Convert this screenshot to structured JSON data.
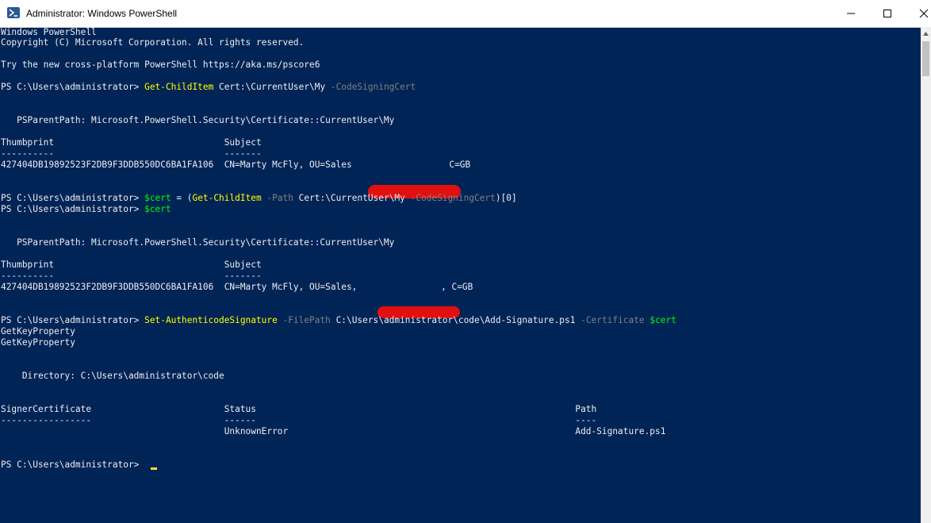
{
  "window": {
    "title": "Administrator: Windows PowerShell",
    "icon": "powershell-icon",
    "controls": [
      "minimize-icon",
      "maximize-icon",
      "close-icon"
    ]
  },
  "colors": {
    "background": "#012456",
    "text": "#eeedf0",
    "command": "#ffff00",
    "parameter": "#808080",
    "variable": "#00ff00",
    "redaction": "#e01010"
  },
  "console": {
    "banner1": "Windows PowerShell",
    "banner2": "Copyright (C) Microsoft Corporation. All rights reserved.",
    "banner3": "Try the new cross-platform PowerShell https://aka.ms/pscore6",
    "prompt": "PS C:\\Users\\administrator> ",
    "cmd1": {
      "command": "Get-ChildItem",
      "arg": " Cert:\\CurrentUser\\My ",
      "param": "-CodeSigningCert"
    },
    "pspath": "   PSParentPath: Microsoft.PowerShell.Security\\Certificate::CurrentUser\\My",
    "cert_table": {
      "header": "Thumbprint                                Subject",
      "underline": "----------                                -------",
      "row1_pre": "427404DB19892523F2DB9F3DDB550DC6BA1FA106  CN=Marty McFly, OU=Sales",
      "row1_post": " C=GB",
      "row2_pre": "427404DB19892523F2DB9F3DDB550DC6BA1FA106  CN=Marty McFly, OU=Sales, ",
      "row2_post": ", C=GB"
    },
    "cmd2": {
      "var": "$cert",
      "eq": " = (",
      "command": "Get-ChildItem",
      "sp": " ",
      "param1": "-Path",
      "arg": " Cert:\\CurrentUser\\My ",
      "param2": "-CodeSigningCert",
      "tail": ")[0]"
    },
    "cmd3": {
      "var": "$cert"
    },
    "cmd4": {
      "command": "Set-AuthenticodeSignature",
      "sp": " ",
      "param1": "-FilePath",
      "arg": " C:\\Users\\administrator\\code\\Add-Signature.ps1 ",
      "param2": "-Certificate",
      "sp2": " ",
      "var": "$cert"
    },
    "getkey1": "GetKeyProperty",
    "getkey2": "GetKeyProperty",
    "directory": "    Directory: C:\\Users\\administrator\\code",
    "sig_table": {
      "header": "SignerCertificate                         Status                                                            Path",
      "underline": "-----------------                         ------                                                            ----",
      "row": "                                          UnknownError                                                      Add-Signature.ps1"
    }
  }
}
